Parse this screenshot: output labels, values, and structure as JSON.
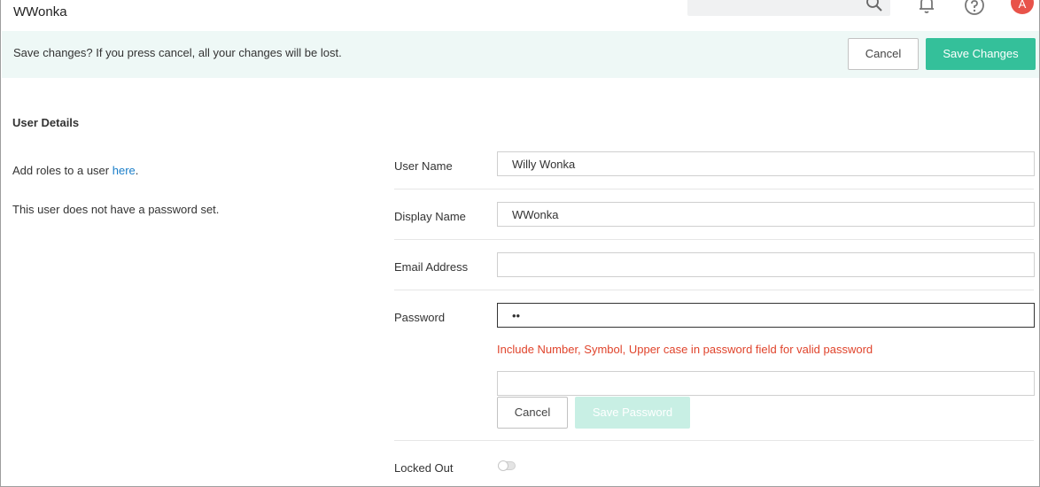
{
  "header": {
    "title": "WWonka",
    "avatar_letter": "A",
    "icons": [
      "search-icon",
      "bell-icon",
      "help-icon"
    ]
  },
  "banner": {
    "message": "Save changes? If you press cancel, all your changes will be lost.",
    "cancel_label": "Cancel",
    "save_label": "Save Changes"
  },
  "details": {
    "section_title": "User Details",
    "roles_prefix": "Add roles to a user ",
    "roles_link": "here",
    "roles_suffix": ".",
    "no_password_text": "This user does not have a password set."
  },
  "form": {
    "user_name": {
      "label": "User Name",
      "value": "Willy Wonka"
    },
    "display_name": {
      "label": "Display Name",
      "value": "WWonka"
    },
    "email": {
      "label": "Email Address",
      "value": ""
    },
    "password": {
      "label": "Password",
      "value": "••",
      "error": "Include Number, Symbol, Upper case in password field for valid password",
      "confirm_value": "",
      "cancel_label": "Cancel",
      "save_label": "Save Password"
    },
    "locked_out": {
      "label": "Locked Out",
      "enabled": false
    }
  },
  "colors": {
    "primary": "#34c09a",
    "banner_bg": "#eef8f6",
    "error": "#e0442c",
    "link": "#1a7ec9",
    "avatar": "#e8534a"
  }
}
